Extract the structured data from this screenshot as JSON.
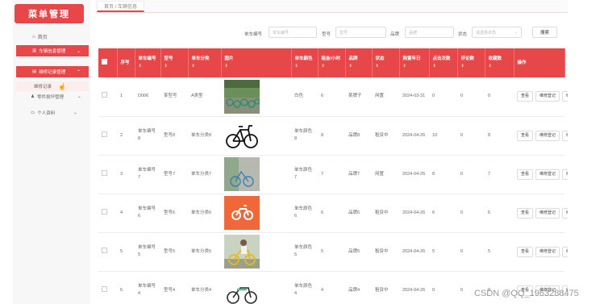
{
  "app": {
    "title": "菜单管理"
  },
  "sidebar": {
    "home": "首页",
    "items": [
      {
        "label": "车辆信息管理",
        "expanded": true
      },
      {
        "label": "维修记录管理",
        "expanded": true,
        "sub": "维修记录"
      },
      {
        "label": "零件损坏管理"
      },
      {
        "label": "个人资料"
      }
    ]
  },
  "breadcrumb": "首页 / 车辆信息",
  "search": {
    "fields": [
      {
        "label": "单车编号",
        "placeholder": "单车编号"
      },
      {
        "label": "型号",
        "placeholder": "型号"
      },
      {
        "label": "品牌",
        "placeholder": "品牌"
      },
      {
        "label": "状态",
        "placeholder": "请选择状态"
      }
    ],
    "button": "搜索"
  },
  "table": {
    "columns": [
      "序号",
      "单车编号",
      "型号",
      "单车分类",
      "图片",
      "单车颜色",
      "租金/小时",
      "品牌",
      "状态",
      "购置年日",
      "点击次数",
      "评论数",
      "收藏数",
      "操作"
    ],
    "rows": [
      {
        "no": "1",
        "code": "D006",
        "model": "某型号",
        "category": "A类型",
        "image": "bike-row",
        "color": "白色",
        "rent": "6",
        "brand": "某牌子",
        "status": "闲置",
        "date": "2024-03-31",
        "clicks": "0",
        "comments": "0",
        "favorites": "0"
      },
      {
        "no": "2",
        "code": "单车编号8",
        "model": "型号8",
        "category": "单车分类8",
        "image": "black-bike",
        "color": "单车颜色8",
        "rent": "8",
        "brand": "品牌8",
        "status": "租赁中",
        "date": "2024-04-26",
        "clicks": "10",
        "comments": "0",
        "favorites": "8"
      },
      {
        "no": "3",
        "code": "单车编号7",
        "model": "型号7",
        "category": "单车分类7",
        "image": "road-bike",
        "color": "单车颜色7",
        "rent": "7",
        "brand": "品牌7",
        "status": "闲置",
        "date": "2024-04-26",
        "clicks": "8",
        "comments": "0",
        "favorites": "7"
      },
      {
        "no": "4",
        "code": "单车编号6",
        "model": "型号6",
        "category": "单车分类6",
        "image": "orange-logo",
        "color": "单车颜色6",
        "rent": "6",
        "brand": "品牌6",
        "status": "租赁中",
        "date": "2024-04-26",
        "clicks": "6",
        "comments": "0",
        "favorites": "6"
      },
      {
        "no": "5",
        "code": "单车编号5",
        "model": "型号5",
        "category": "单车分类5",
        "image": "yellow-bike",
        "color": "单车颜色5",
        "rent": "5",
        "brand": "品牌5",
        "status": "租赁中",
        "date": "2024-04-26",
        "clicks": "5",
        "comments": "0",
        "favorites": "5"
      },
      {
        "no": "6",
        "code": "单车编号4",
        "model": "型号4",
        "category": "单车分类4",
        "image": "green-bike",
        "color": "单车颜色4",
        "rent": "4",
        "brand": "品牌4",
        "status": "租赁中",
        "date": "2024-04-26",
        "clicks": "0",
        "comments": "0",
        "favorites": "0"
      }
    ],
    "ops": [
      "查看",
      "维修登记",
      "修"
    ]
  },
  "watermark": "CSDN @QQ_1963288475",
  "colors": {
    "accent": "#e8474a",
    "sidebar_bg": "#f7f7f7"
  }
}
